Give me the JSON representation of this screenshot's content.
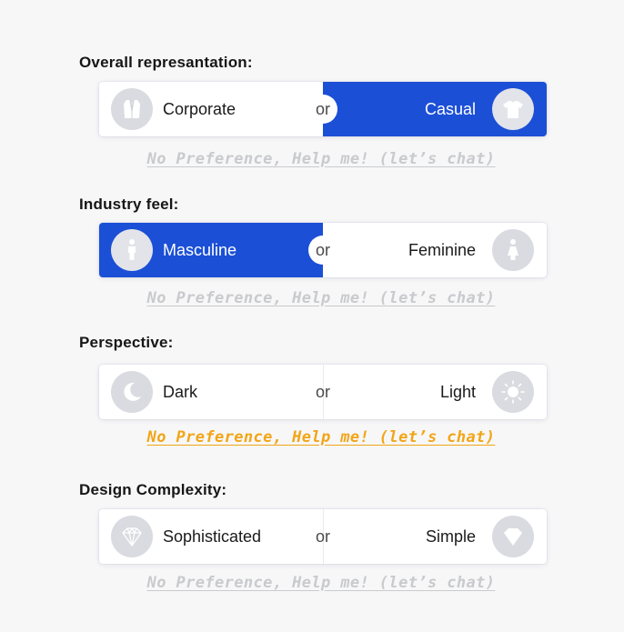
{
  "colors": {
    "selected_bg": "#1b4fd6",
    "help_inactive": "#c9cacd",
    "help_active": "#f2a516",
    "icon_bg": "#d9dbe0"
  },
  "sections": [
    {
      "label": "Overall represantation:",
      "left": {
        "label": "Corporate",
        "icon": "suit-icon",
        "selected": false
      },
      "or_label": "or",
      "right": {
        "label": "Casual",
        "icon": "tshirt-icon",
        "selected": true
      },
      "help": {
        "text": "No Preference, Help me! (let’s chat)",
        "active": false
      }
    },
    {
      "label": "Industry feel:",
      "left": {
        "label": "Masculine",
        "icon": "man-icon",
        "selected": true
      },
      "or_label": "or",
      "right": {
        "label": "Feminine",
        "icon": "woman-icon",
        "selected": false
      },
      "help": {
        "text": "No Preference, Help me! (let’s chat)",
        "active": false
      }
    },
    {
      "label": "Perspective:",
      "left": {
        "label": "Dark",
        "icon": "moon-icon",
        "selected": false
      },
      "or_label": "or",
      "right": {
        "label": "Light",
        "icon": "sun-icon",
        "selected": false
      },
      "help": {
        "text": "No Preference, Help me! (let’s chat)",
        "active": true
      }
    },
    {
      "label": "Design Complexity:",
      "left": {
        "label": "Sophisticated",
        "icon": "faceted-diamond-icon",
        "selected": false
      },
      "or_label": "or",
      "right": {
        "label": "Simple",
        "icon": "simple-diamond-icon",
        "selected": false
      },
      "help": {
        "text": "No Preference, Help me! (let’s chat)",
        "active": false
      }
    }
  ]
}
